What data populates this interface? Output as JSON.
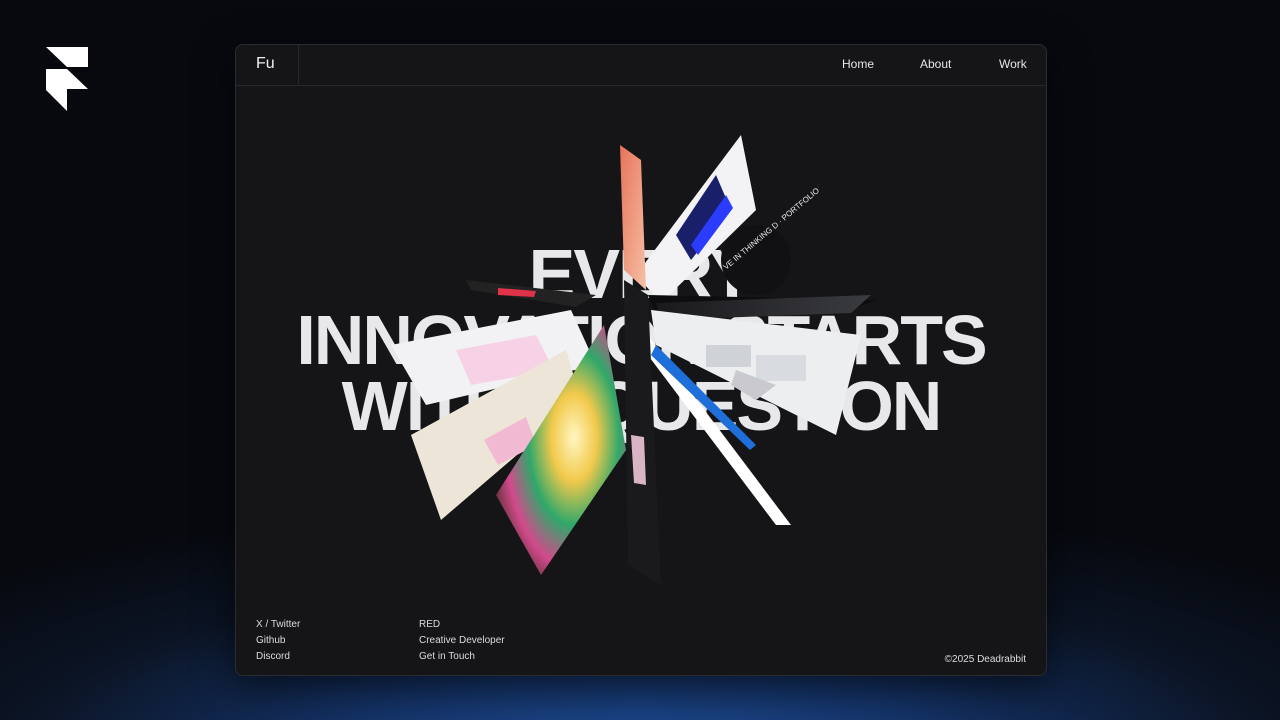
{
  "brand": {
    "short": "Fu"
  },
  "nav": {
    "home": "Home",
    "about": "About",
    "work": "Work"
  },
  "hero": {
    "line1": "EVERY",
    "line2": "INNOVATION STARTS",
    "line3": "WITH A QUESTION",
    "badge_text": "VE IN THINKING D · PORTFOLIO"
  },
  "footer": {
    "social": [
      "X / Twitter",
      "Github",
      "Discord"
    ],
    "info": [
      "RED",
      "Creative Developer",
      "Get in Touch"
    ],
    "copyright": "©2025 Deadrabbit"
  },
  "icons": {
    "logo": "framer-logo"
  },
  "colors": {
    "accent_blue": "#1e6fd9",
    "window_bg": "#151517",
    "text": "#e8e8ea"
  }
}
